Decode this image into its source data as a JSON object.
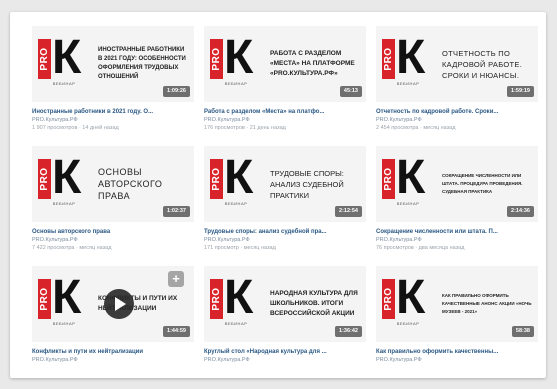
{
  "videos": [
    {
      "thumb_text": "Иностранные работники в 2021 году: особенности оформления трудовых отношений",
      "duration": "1:09:26",
      "title": "Иностранные работники в 2021 году. О...",
      "channel": "PRO.Культура.РФ",
      "meta": "1 907 просмотров · 14 дней назад"
    },
    {
      "thumb_text": "Работа с разделом «Места» на платформе «PRO.Культура.РФ»",
      "duration": "45:13",
      "title": "Работа с разделом «Места» на платфо...",
      "channel": "PRO.Культура.РФ",
      "meta": "176 просмотров · 21 день назад"
    },
    {
      "thumb_text": "Отчетность по кадровой работе. Сроки и нюансы.",
      "duration": "1:59:19",
      "title": "Отчетность по кадровой работе. Сроки...",
      "channel": "PRO.Культура.РФ",
      "meta": "2 454 просмотра · месяц назад"
    },
    {
      "thumb_text": "Основы авторского права",
      "duration": "1:02:37",
      "title": "Основы авторского права",
      "channel": "PRO.Культура.РФ",
      "meta": "7 422 просмотра · месяц назад"
    },
    {
      "thumb_text": "Трудовые споры: анализ судебной практики",
      "duration": "2:12:54",
      "title": "Трудовые споры: анализ судебной пра...",
      "channel": "PRO.Культура.РФ",
      "meta": "171 просмотр · месяц назад"
    },
    {
      "thumb_text": "Сокращение численности или штата. Процедура проведения. Судебная практика",
      "duration": "2:14:36",
      "title": "Сокращение численности или штата. П...",
      "channel": "PRO.Культура.РФ",
      "meta": "76 просмотров · два месяца назад"
    },
    {
      "thumb_text": "Конфликты и пути их нейтрализации",
      "duration": "1:44:59",
      "title": "Конфликты и пути их нейтрализации",
      "channel": "PRO.Культура.РФ",
      "meta": ""
    },
    {
      "thumb_text": "Народная культура для школьников. Итоги всероссийской акции",
      "duration": "1:36:42",
      "title": "Круглый стол «Народная культура для ...",
      "channel": "PRO.Культура.РФ",
      "meta": ""
    },
    {
      "thumb_text": "Как правильно оформить качественные анонс акции «Ночь музеев - 2021»",
      "duration": "58:38",
      "title": "Как правильно оформить качественны...",
      "channel": "PRO.Культура.РФ",
      "meta": ""
    }
  ],
  "logo": {
    "pro": "PRO",
    "k": "К",
    "sub": "ВЕБИНАР"
  },
  "add_button": "+",
  "colors": {
    "accent_red": "#d9232a",
    "link_blue": "#2a5885"
  }
}
